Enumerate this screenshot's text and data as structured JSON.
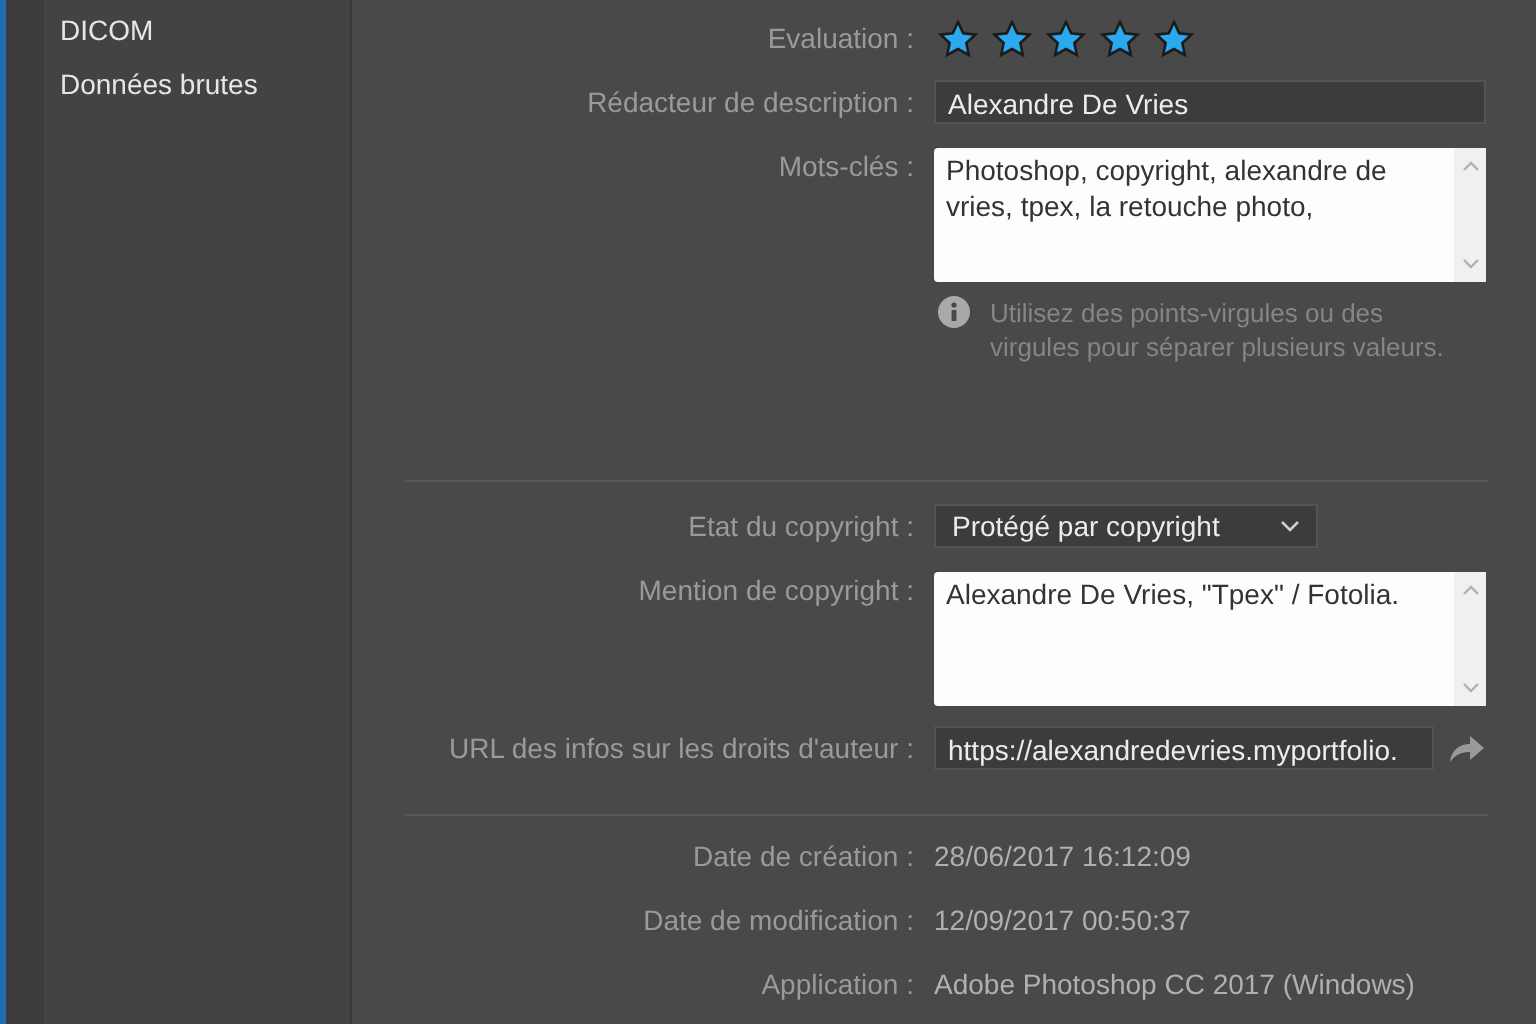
{
  "sidebar": {
    "items": [
      {
        "label": "DICOM"
      },
      {
        "label": "Données brutes"
      }
    ]
  },
  "sections": [
    {
      "fields": [
        {
          "kind": "stars",
          "label": "Evaluation :",
          "stars": 5
        },
        {
          "kind": "text",
          "label": "Rédacteur de description :",
          "value": "Alexandre De Vries"
        },
        {
          "kind": "textarea",
          "label": "Mots-clés :",
          "value": "Photoshop, copyright, alexandre de vries, tpex, la retouche photo,",
          "hint": "Utilisez des points-virgules ou des virgules pour séparer plusieurs valeurs."
        }
      ]
    },
    {
      "fields": [
        {
          "kind": "select",
          "label": "Etat du copyright :",
          "value": "Protégé par copyright"
        },
        {
          "kind": "textarea",
          "label": "Mention de copyright :",
          "value": "Alexandre De Vries, \"Tpex\" / Fotolia."
        },
        {
          "kind": "url",
          "label": "URL des infos sur les droits d'auteur :",
          "value": "https://alexandredevries.myportfolio."
        }
      ]
    },
    {
      "fields": [
        {
          "kind": "info",
          "label": "Date de création :",
          "value": "28/06/2017 16:12:09"
        },
        {
          "kind": "info",
          "label": "Date de modification :",
          "value": "12/09/2017 00:50:37"
        },
        {
          "kind": "info",
          "label": "Application :",
          "value": "Adobe Photoshop CC 2017 (Windows)"
        }
      ]
    }
  ]
}
